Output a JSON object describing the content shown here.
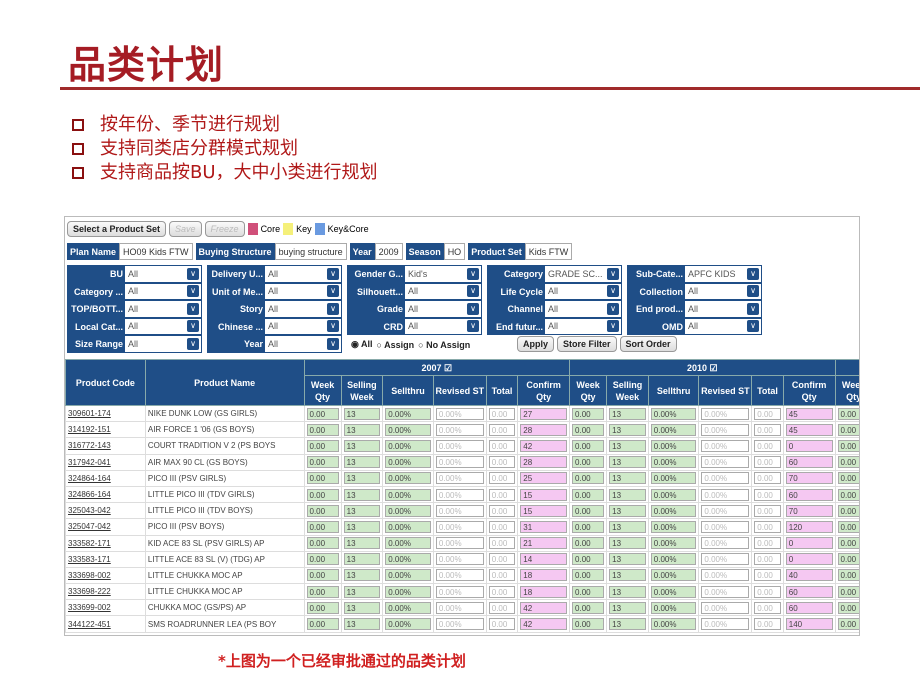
{
  "slide": {
    "title": "品类计划",
    "bullets": [
      "按年份、季节进行规划",
      "支持同类店分群模式规划",
      "支持商品按BU，大中小类进行规划"
    ],
    "note": "*上图为一个已经审批通过的品类计划"
  },
  "toolbar": {
    "select": "Select a Product Set",
    "save": "Save",
    "freeze": "Freeze",
    "legend": [
      {
        "label": "Core",
        "color": "#d0507a"
      },
      {
        "label": "Key",
        "color": "#f5f07a"
      },
      {
        "label": "Key&Core",
        "color": "#6a9ae0"
      }
    ]
  },
  "plan": [
    {
      "label": "Plan Name",
      "value": "HO09 Kids FTW"
    },
    {
      "label": "Buying Structure",
      "value": "buying structure"
    },
    {
      "label": "Year",
      "value": "2009"
    },
    {
      "label": "Season",
      "value": "HO"
    },
    {
      "label": "Product Set",
      "value": "Kids FTW"
    }
  ],
  "filters": [
    {
      "label": "BU",
      "value": "All"
    },
    {
      "label": "Delivery U...",
      "value": "All"
    },
    {
      "label": "Gender G...",
      "value": "Kid's"
    },
    {
      "label": "Category",
      "value": "GRADE SC..."
    },
    {
      "label": "Sub-Cate...",
      "value": "APFC KIDS"
    },
    {
      "label": "Category ...",
      "value": "All"
    },
    {
      "label": "Unit of Me...",
      "value": "All"
    },
    {
      "label": "Silhouett...",
      "value": "All"
    },
    {
      "label": "Life Cycle",
      "value": "All"
    },
    {
      "label": "Collection",
      "value": "All"
    },
    {
      "label": "TOP/BOTT...",
      "value": "All"
    },
    {
      "label": "Story",
      "value": "All"
    },
    {
      "label": "Grade",
      "value": "All"
    },
    {
      "label": "Channel",
      "value": "All"
    },
    {
      "label": "End prod...",
      "value": "All"
    },
    {
      "label": "Local Cat...",
      "value": "All"
    },
    {
      "label": "Chinese ...",
      "value": "All"
    },
    {
      "label": "CRD",
      "value": "All"
    },
    {
      "label": "End futur...",
      "value": "All"
    },
    {
      "label": "OMD",
      "value": "All"
    },
    {
      "label": "Size Range",
      "value": "All"
    },
    {
      "label": "Year",
      "value": "All"
    }
  ],
  "radios": {
    "options": [
      "All",
      "Assign",
      "No Assign"
    ],
    "selected": "All"
  },
  "actions": {
    "apply": "Apply",
    "store_filter": "Store Filter",
    "sort_order": "Sort Order"
  },
  "table": {
    "headers": {
      "code": "Product Code",
      "name": "Product Name",
      "years": [
        "2007",
        "2010",
        "2"
      ],
      "sub": [
        "Week Qty",
        "Selling Week",
        "Sellthru",
        "Revised ST",
        "Total",
        "Confirm Qty"
      ]
    },
    "defaults": {
      "week_qty": "0.00",
      "selling_week": "13",
      "sellthru": "0.00%",
      "revised_st": "0.00%",
      "total": "0.00"
    },
    "rows": [
      {
        "code": "309601-174",
        "name": "NIKE DUNK LOW (GS GIRLS)",
        "c2007": "27",
        "c2010": "45"
      },
      {
        "code": "314192-151",
        "name": "AIR FORCE 1 '06 (GS BOYS)",
        "c2007": "28",
        "c2010": "45"
      },
      {
        "code": "316772-143",
        "name": "COURT TRADITION V 2 (PS BOYS",
        "c2007": "42",
        "c2010": "0"
      },
      {
        "code": "317942-041",
        "name": "AIR MAX 90 CL (GS BOYS)",
        "c2007": "28",
        "c2010": "60"
      },
      {
        "code": "324864-164",
        "name": "PICO III (PSV GIRLS)",
        "c2007": "25",
        "c2010": "70"
      },
      {
        "code": "324866-164",
        "name": "LITTLE PICO III (TDV GIRLS)",
        "c2007": "15",
        "c2010": "60"
      },
      {
        "code": "325043-042",
        "name": "LITTLE PICO III (TDV BOYS)",
        "c2007": "15",
        "c2010": "70"
      },
      {
        "code": "325047-042",
        "name": "PICO III (PSV BOYS)",
        "c2007": "31",
        "c2010": "120"
      },
      {
        "code": "333582-171",
        "name": "KID ACE 83 SL (PSV GIRLS) AP",
        "c2007": "21",
        "c2010": "0"
      },
      {
        "code": "333583-171",
        "name": "LITTLE ACE 83 SL (V) (TDG) AP",
        "c2007": "14",
        "c2010": "0"
      },
      {
        "code": "333698-002",
        "name": "LITTLE CHUKKA MOC AP",
        "c2007": "18",
        "c2010": "40"
      },
      {
        "code": "333698-222",
        "name": "LITTLE CHUKKA MOC AP",
        "c2007": "18",
        "c2010": "60"
      },
      {
        "code": "333699-002",
        "name": "CHUKKA MOC (GS/PS) AP",
        "c2007": "42",
        "c2010": "60"
      },
      {
        "code": "344122-451",
        "name": "SMS ROADRUNNER LEA (PS BOY",
        "c2007": "42",
        "c2010": "140"
      }
    ]
  }
}
